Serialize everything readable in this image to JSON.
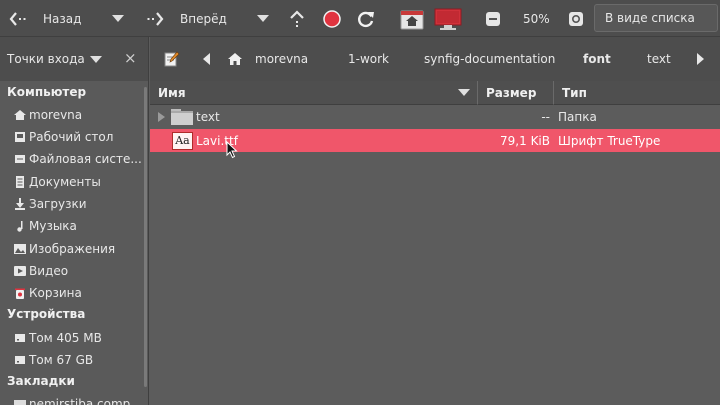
{
  "toolbar": {
    "back_label": "Назад",
    "forward_label": "Вперёд",
    "zoom": "50%",
    "view_mode": "В виде списка"
  },
  "places_header": {
    "label": "Точки входа",
    "close_glyph": "×"
  },
  "pathbar": {
    "crumbs": [
      "morevna",
      "1-work",
      "synfig-documentation",
      "font",
      "text"
    ],
    "current_index": 3
  },
  "sidebar": {
    "sections": {
      "computer": "Компьютер",
      "devices": "Устройства",
      "bookmarks": "Закладки"
    },
    "computer_items": [
      {
        "label": "morevna",
        "icon": "home-icon"
      },
      {
        "label": "Рабочий стол",
        "icon": "desktop-icon"
      },
      {
        "label": "Файловая систе...",
        "icon": "filesystem-icon"
      },
      {
        "label": "Документы",
        "icon": "documents-icon"
      },
      {
        "label": "Загрузки",
        "icon": "downloads-icon"
      },
      {
        "label": "Музыка",
        "icon": "music-icon"
      },
      {
        "label": "Изображения",
        "icon": "pictures-icon"
      },
      {
        "label": "Видео",
        "icon": "video-icon"
      },
      {
        "label": "Корзина",
        "icon": "trash-icon"
      }
    ],
    "device_items": [
      {
        "label": "Том 405 MB",
        "icon": "drive-icon"
      },
      {
        "label": "Том 67 GB",
        "icon": "drive-icon"
      }
    ],
    "bookmark_items": [
      {
        "label": "nemirstiba.comp...",
        "icon": "folder-icon"
      }
    ]
  },
  "filelist": {
    "columns": {
      "name": "Имя",
      "size": "Размер",
      "type": "Тип"
    },
    "rows": [
      {
        "name": "text",
        "size": "--",
        "type": "Папка",
        "icon": "folder-icon",
        "selected": false
      },
      {
        "name": "Lavi.ttf",
        "size": "79,1 KiB",
        "type": "Шрифт TrueType",
        "icon": "font-file-icon",
        "icon_text": "Aa",
        "selected": true
      }
    ]
  },
  "colors": {
    "selection": "#f0566a",
    "record": "#e0333f"
  }
}
